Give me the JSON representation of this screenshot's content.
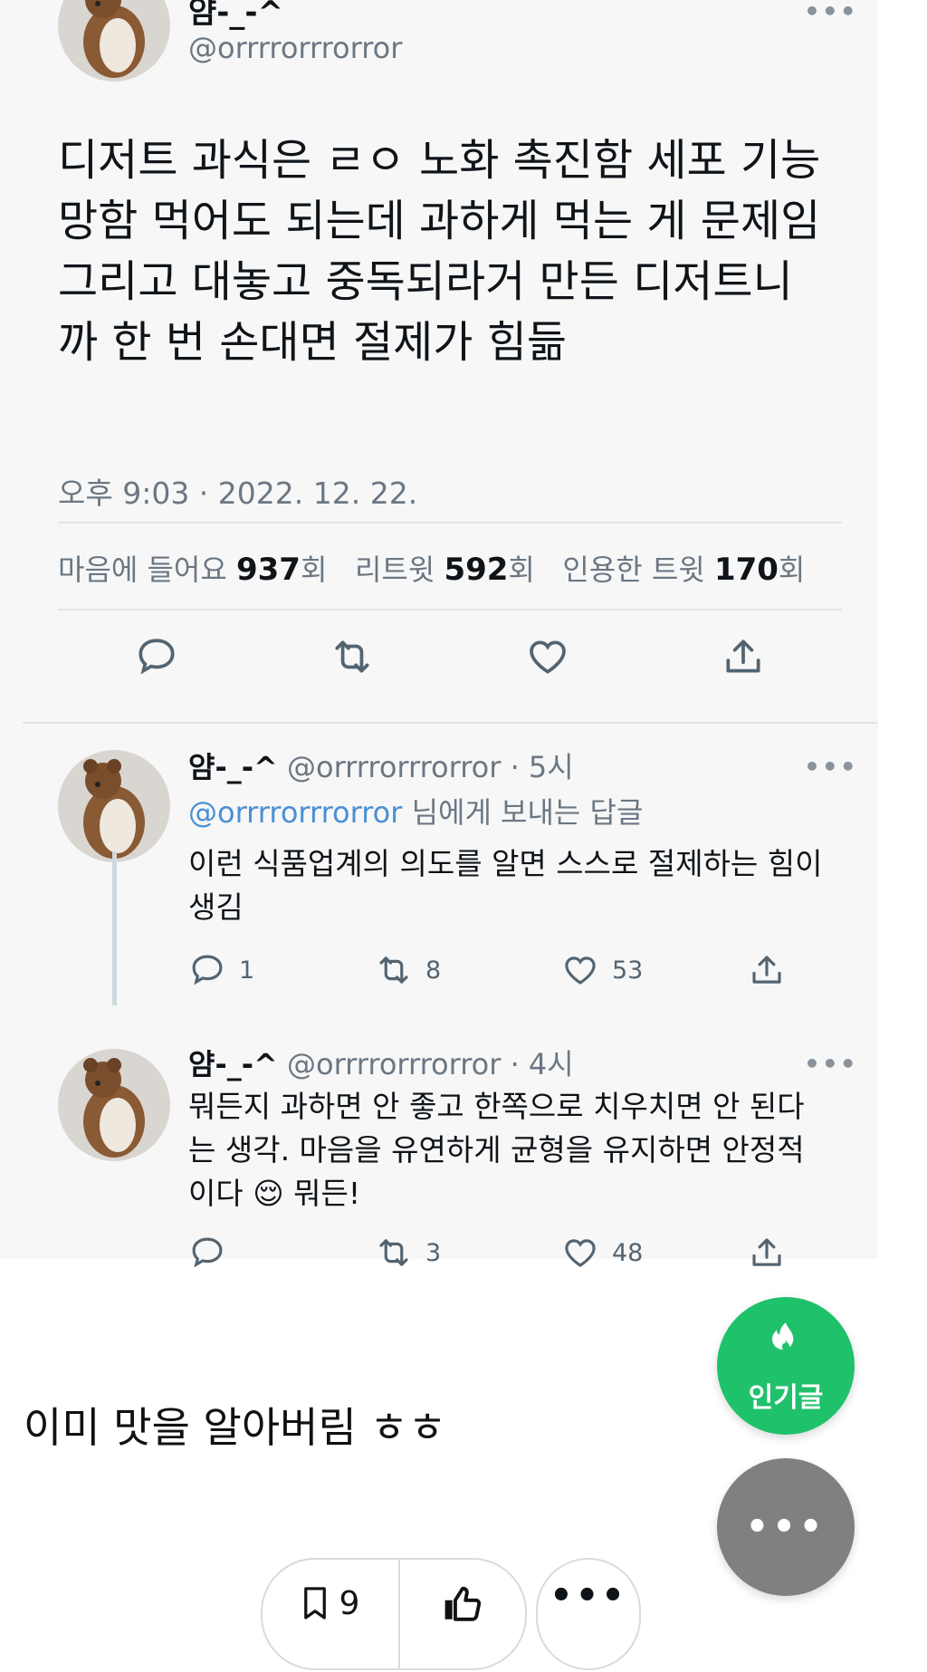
{
  "tweet": {
    "name": "얌-_-^",
    "handle": "@orrrrorrrorror",
    "more": "•••",
    "text_lines": [
      "디저트 과식은 ㄹㅇ 노화 촉진함 세포 기능",
      "망함 먹어도 되는데 과하게 먹는 게 문제임",
      "그리고 대놓고 중독되라거 만든 디저트니",
      "까 한 번 손대면 절제가 힘듦"
    ],
    "timestamp": "오후 9:03 · 2022. 12. 22.",
    "stats": {
      "likes_label": "마음에 들어요",
      "likes_count": "937",
      "likes_unit": "회",
      "retweets_label": "리트윗",
      "retweets_count": "592",
      "retweets_unit": "회",
      "quotes_label": "인용한 트윗",
      "quotes_count": "170",
      "quotes_unit": "회"
    }
  },
  "replies": [
    {
      "name": "얌-_-^",
      "handle": "@orrrrorrrorror",
      "time": "· 5시",
      "more": "•••",
      "reply_to_handle": "@orrrrorrrorror",
      "reply_to_suffix": " 님에게 보내는 답글",
      "text_lines": [
        "이런 식품업계의 의도를 알면 스스로 절제하는 힘이",
        "생김"
      ],
      "comments": "1",
      "retweets": "8",
      "likes": "53"
    },
    {
      "name": "얌-_-^",
      "handle": "@orrrrorrrorror",
      "time": "· 4시",
      "more": "•••",
      "text_lines": [
        "뭐든지 과하면 안 좋고 한쪽으로 치우치면 안 된다",
        "는 생각. 마음을 유연하게 균형을 유지하면 안정적"
      ],
      "text_line3_before": "이다 ",
      "emoji": "😌",
      "text_line3_after": " 뭐든!",
      "comments": "",
      "retweets": "3",
      "likes": "48"
    }
  ],
  "caption": "이미 맛을 알아버림 ㅎㅎ",
  "fab": {
    "popular_label": "인기글",
    "more_label": "•••"
  },
  "bottom_bar": {
    "bookmark_count": "9",
    "more_label": "•••"
  },
  "colors": {
    "accent_green": "#1fc16b",
    "link_blue": "#4a8fd4",
    "muted": "#6b7783"
  }
}
